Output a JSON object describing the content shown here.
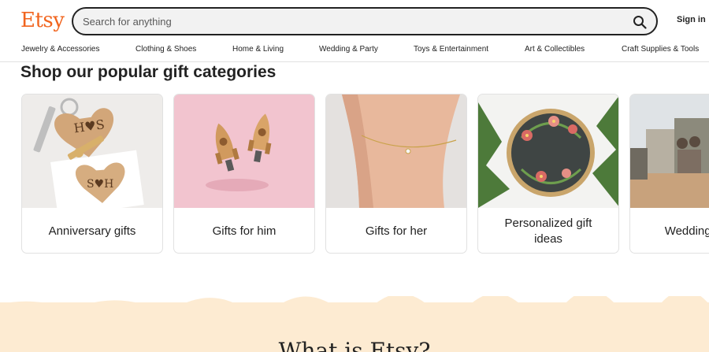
{
  "header": {
    "logo": "Etsy",
    "search_placeholder": "Search for anything",
    "search_icon": "search-icon",
    "signin_label": "Sign in"
  },
  "nav": {
    "items": [
      "Jewelry & Accessories",
      "Clothing & Shoes",
      "Home & Living",
      "Wedding & Party",
      "Toys & Entertainment",
      "Art & Collectibles",
      "Craft Supplies & Tools"
    ]
  },
  "section": {
    "title": "Shop our popular gift categories",
    "cards": [
      {
        "label": "Anniversary gifts",
        "image": "engraved-heart-keyrings"
      },
      {
        "label": "Gifts for him",
        "image": "rocket-cufflinks"
      },
      {
        "label": "Gifts for her",
        "image": "gold-anklet"
      },
      {
        "label": "Personalized gift ideas",
        "image": "embroidery-hoop-wreath"
      },
      {
        "label": "Wedding gifts",
        "image": "photo-puzzle"
      }
    ]
  },
  "footer_teaser": {
    "title": "What is Etsy?"
  },
  "colors": {
    "brand": "#f1641e",
    "text": "#222222",
    "search_bg": "#f2f2f2",
    "cream_band": "#fdebd2",
    "border": "#e1e1e1"
  }
}
